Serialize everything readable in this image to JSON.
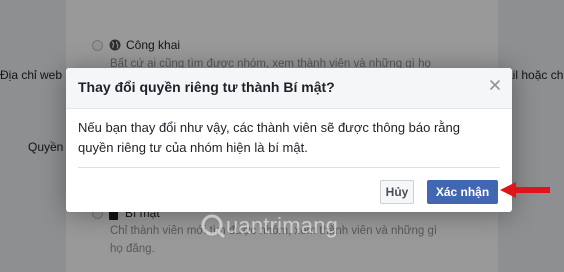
{
  "background": {
    "left_label": "Địa chỉ web",
    "right_label": "ail hoặc ch",
    "left_label_2": "Quyền",
    "public_option": {
      "label": "Công khai",
      "description": "Bất cứ ai cũng tìm được nhóm, xem thành viên và những gì họ"
    },
    "secret_option": {
      "label": "Bí mật",
      "description_line1": "Chỉ thành viên mới tìm được nhóm, xem thành viên và những gì",
      "description_line2": "họ đăng."
    }
  },
  "dialog": {
    "title": "Thay đổi quyền riêng tư thành Bí mật?",
    "body_line1": "Nếu bạn thay đổi như vậy, các thành viên sẽ được thông báo rằng",
    "body_line2": "quyền riêng tư của nhóm hiện là bí mật.",
    "cancel_label": "Hủy",
    "confirm_label": "Xác nhận"
  },
  "watermark": {
    "text": "uantrimang"
  },
  "colors": {
    "accent": "#4267b2",
    "arrow": "#e0151c"
  },
  "icons": {
    "close": "close-icon",
    "globe": "globe-icon",
    "lock": "lock-icon",
    "arrow": "red-arrow-icon"
  }
}
